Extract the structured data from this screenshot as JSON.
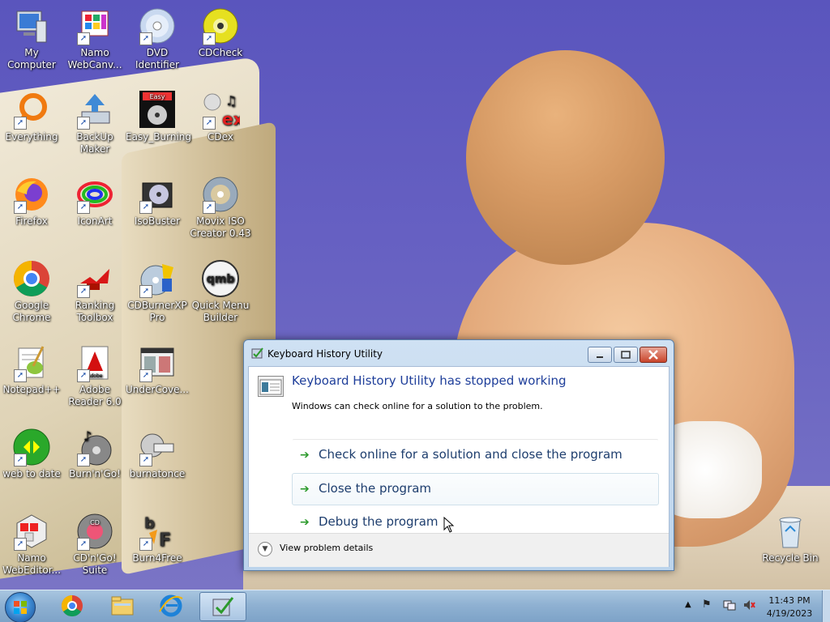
{
  "desktop_icons": [
    {
      "label": "My Computer"
    },
    {
      "label": "Namo WebCanv..."
    },
    {
      "label": "DVD Identifier"
    },
    {
      "label": "CDCheck"
    },
    {
      "label": "Everything"
    },
    {
      "label": "BackUp Maker"
    },
    {
      "label": "Easy_Burning"
    },
    {
      "label": "CDex"
    },
    {
      "label": "Firefox"
    },
    {
      "label": "IconArt"
    },
    {
      "label": "IsoBuster"
    },
    {
      "label": "Movix ISO Creator 0.43"
    },
    {
      "label": "Google Chrome"
    },
    {
      "label": "Ranking Toolbox"
    },
    {
      "label": "CDBurnerXP Pro"
    },
    {
      "label": "Quick Menu Builder"
    },
    {
      "label": "Notepad++"
    },
    {
      "label": "Adobe Reader 6.0"
    },
    {
      "label": "UnderCove..."
    },
    {
      "label": "web to date"
    },
    {
      "label": "Burn'n'Go!"
    },
    {
      "label": "burnatonce"
    },
    {
      "label": "Namo WebEditor..."
    },
    {
      "label": "CD'n'Go! Suite"
    },
    {
      "label": "Burn4Free"
    },
    {
      "label": "Recycle Bin"
    }
  ],
  "icon_text": {
    "easy": "Easy",
    "qmb": "qmb",
    "cdex": "ex",
    "adobe": "Adobe",
    "cd60": "CD",
    "bf": "F"
  },
  "dialog": {
    "title": "Keyboard History Utility",
    "heading": "Keyboard History Utility has stopped working",
    "subtext": "Windows can check online for a solution to the problem.",
    "options": [
      {
        "label": "Check online for a solution and close the program"
      },
      {
        "label": "Close the program"
      },
      {
        "label": "Debug the program"
      }
    ],
    "details_label": "View problem details"
  },
  "taskbar": {
    "time": "11:43 PM",
    "date": "4/19/2023"
  },
  "colors": {
    "link_blue": "#1e3e9a",
    "arrow_green": "#2c9a2c"
  }
}
